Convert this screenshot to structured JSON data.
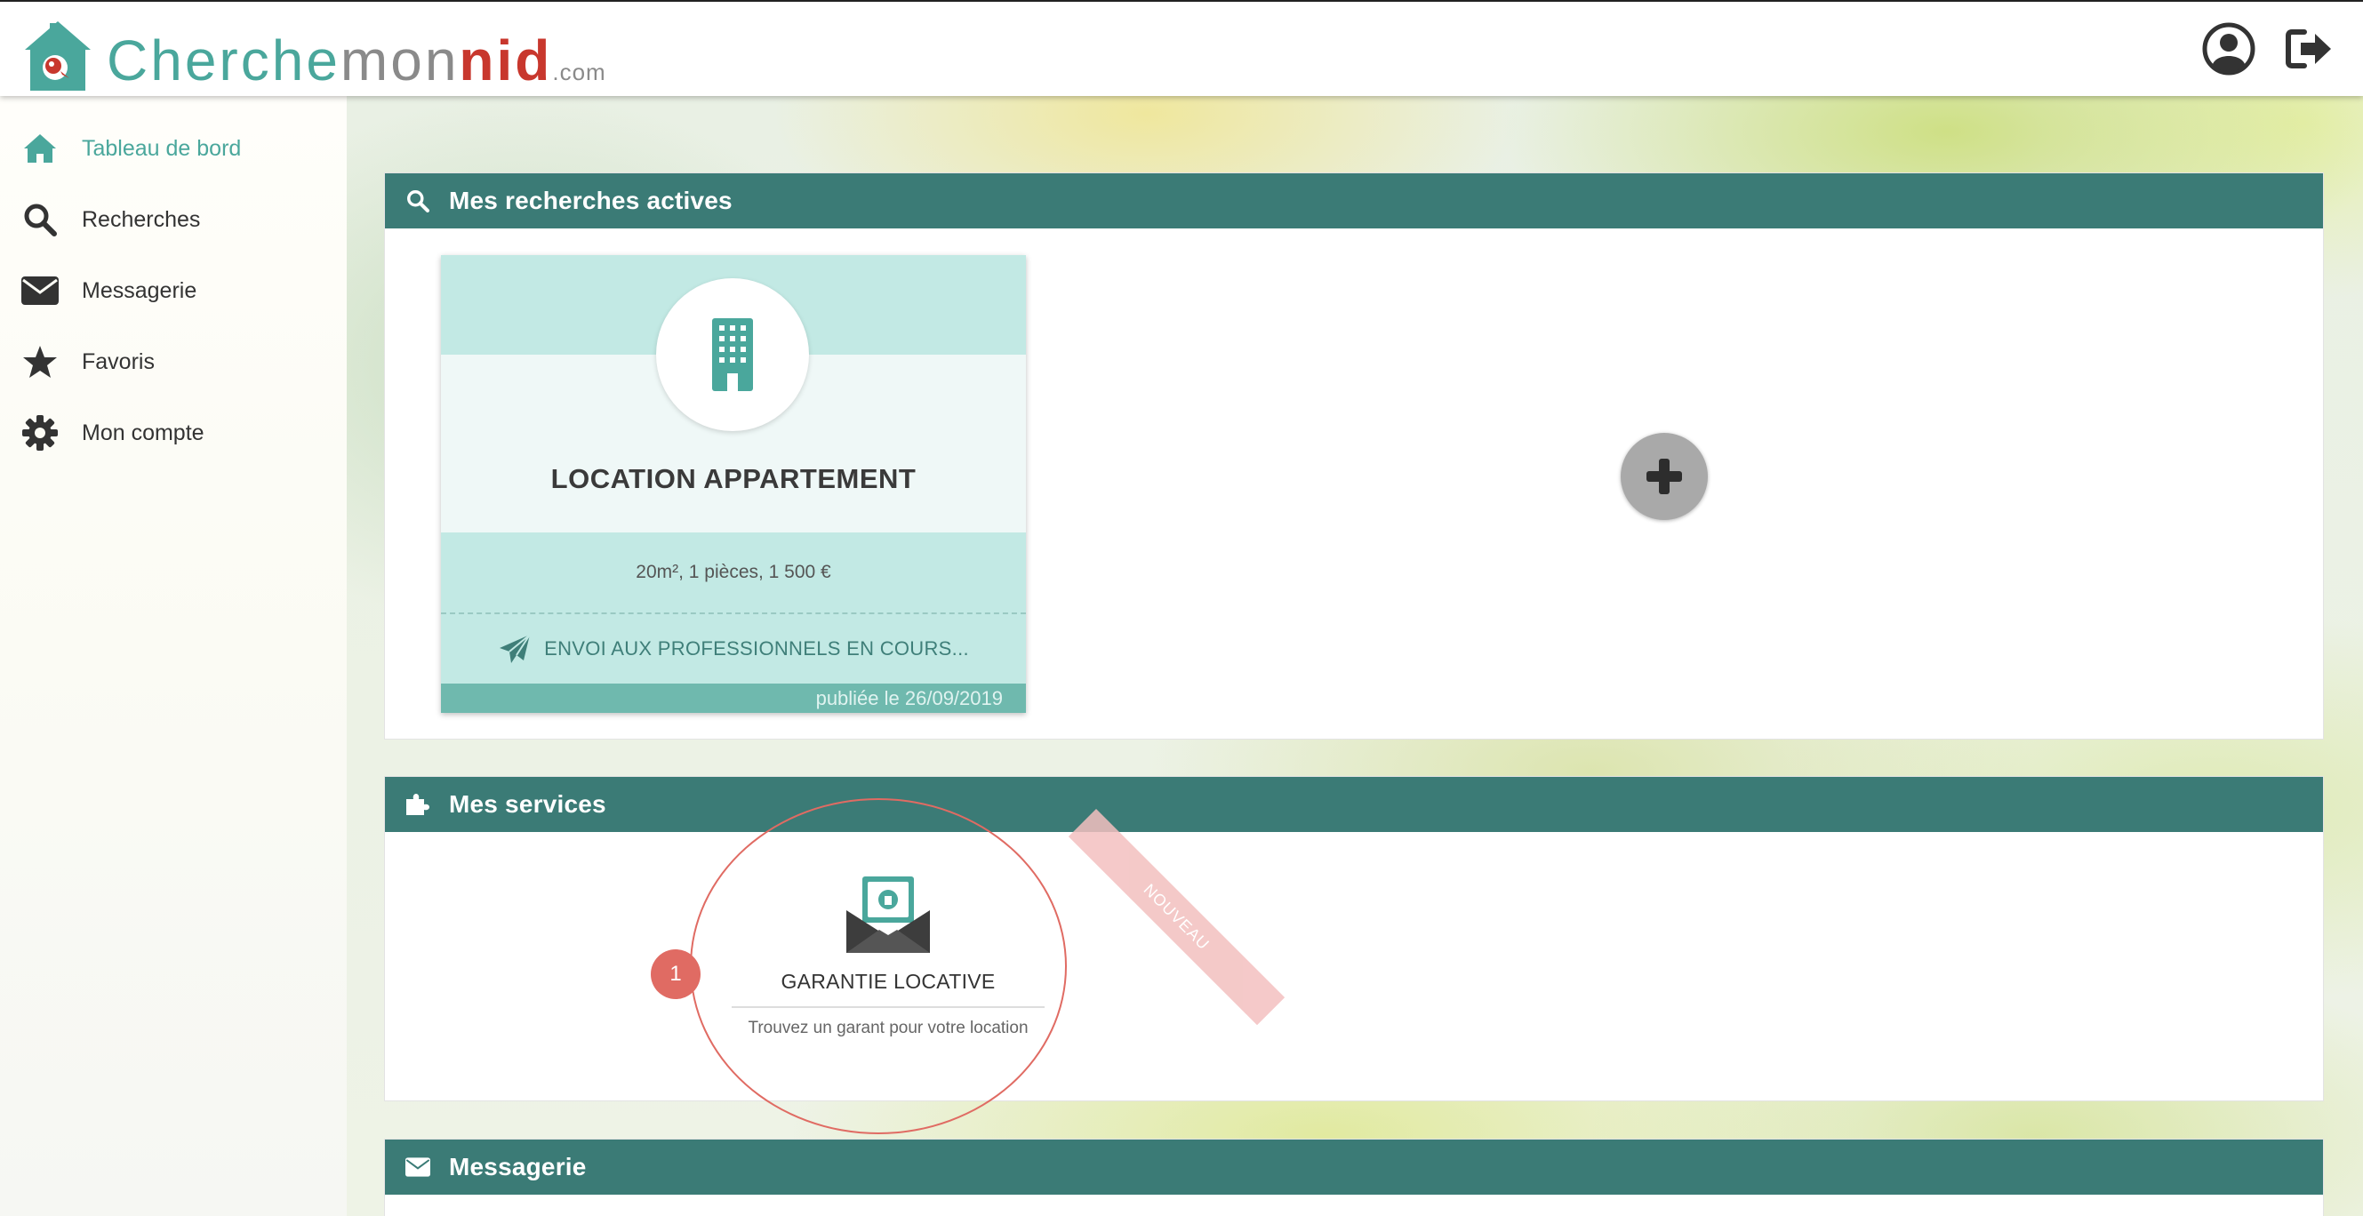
{
  "header": {
    "logo": {
      "part1": "Cherche",
      "part2": "mon",
      "part3": "nid",
      "part4": ".com"
    },
    "icons": [
      "user-circle-icon",
      "logout-icon"
    ]
  },
  "sidebar": {
    "items": [
      {
        "label": "Tableau de bord",
        "icon": "home-icon",
        "active": true
      },
      {
        "label": "Recherches",
        "icon": "search-icon",
        "active": false
      },
      {
        "label": "Messagerie",
        "icon": "envelope-icon",
        "active": false
      },
      {
        "label": "Favoris",
        "icon": "star-icon",
        "active": false
      },
      {
        "label": "Mon compte",
        "icon": "gear-icon",
        "active": false
      }
    ]
  },
  "panels": {
    "searches": {
      "title": "Mes recherches actives",
      "card": {
        "title": "LOCATION APPARTEMENT",
        "info": "20m², 1 pièces, 1 500 €",
        "status": "ENVOI AUX PROFESSIONNELS EN COURS...",
        "published": "publiée le 26/09/2019"
      }
    },
    "services": {
      "title": "Mes services",
      "service": {
        "title": "GARANTIE LOCATIVE",
        "desc": "Trouvez un garant pour votre location"
      },
      "ribbon": "NOUVEAU"
    },
    "messages": {
      "title": "Messagerie"
    }
  },
  "annotation": {
    "step": "1"
  },
  "colors": {
    "teal": "#3b7b76",
    "accent": "#4aa79c",
    "highlight": "#e06b63"
  }
}
